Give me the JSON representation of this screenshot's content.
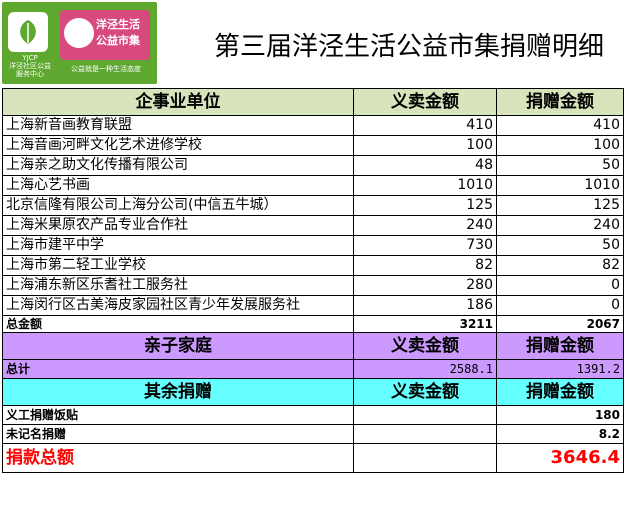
{
  "header": {
    "title": "第三届洋泾生活公益市集捐赠明细",
    "logo": {
      "org_abbr": "YJCP",
      "org_name": "洋泾社区公益服务中心",
      "badge_line1": "洋泾生活",
      "badge_line2": "公益市集",
      "slogan": "公益就是一种生活态度"
    }
  },
  "section1": {
    "headers": [
      "企事业单位",
      "义卖金额",
      "捐赠金额"
    ],
    "rows": [
      {
        "name": "上海新音画教育联盟",
        "sale": "410",
        "donation": "410"
      },
      {
        "name": "上海音画河畔文化艺术进修学校",
        "sale": "100",
        "donation": "100"
      },
      {
        "name": "上海亲之助文化传播有限公司",
        "sale": "48",
        "donation": "50"
      },
      {
        "name": "上海心艺书画",
        "sale": "1010",
        "donation": "1010"
      },
      {
        "name": "北京信隆有限公司上海分公司(中信五牛城）",
        "sale": "125",
        "donation": "125"
      },
      {
        "name": "上海米果原农产品专业合作社",
        "sale": "240",
        "donation": "240"
      },
      {
        "name": "上海市建平中学",
        "sale": "730",
        "donation": "50"
      },
      {
        "name": "上海市第二轻工业学校",
        "sale": "82",
        "donation": "82"
      },
      {
        "name": "上海浦东新区乐耆社工服务社",
        "sale": "280",
        "donation": "0"
      },
      {
        "name": "上海闵行区古美海皮家园社区青少年发展服务社",
        "sale": "186",
        "donation": "0"
      }
    ],
    "total": {
      "label": "总金额",
      "sale": "3211",
      "donation": "2067"
    }
  },
  "section2": {
    "headers": [
      "亲子家庭",
      "义卖金额",
      "捐赠金额"
    ],
    "total": {
      "label": "总计",
      "sale": "2588.1",
      "donation": "1391.2"
    }
  },
  "section3": {
    "headers": [
      "其余捐赠",
      "义卖金额",
      "捐赠金额"
    ],
    "rows": [
      {
        "name": "义工捐赠饭贴",
        "donation": "180"
      },
      {
        "name": "未记名捐赠",
        "donation": "8.2"
      }
    ]
  },
  "grand_total": {
    "label": "捐款总额",
    "value": "3646.4"
  },
  "colors": {
    "green_band": "#d8e4bc",
    "purple_band": "#cc99ff",
    "cyan_band": "#66ffff",
    "highlight": "#ff0000",
    "logo_green": "#5fa830",
    "logo_pink": "#d84a7e"
  }
}
